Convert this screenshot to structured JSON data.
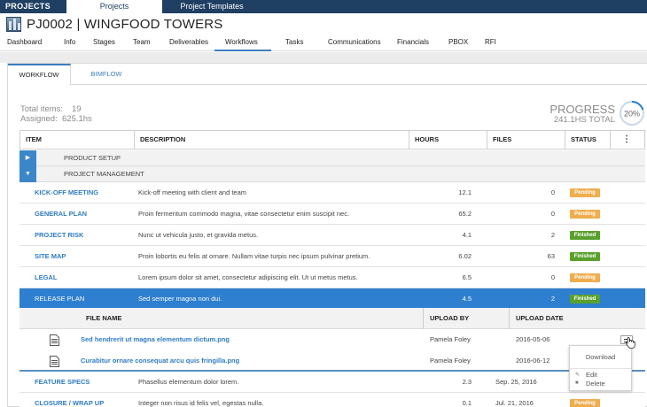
{
  "topbar": {
    "brand": "PROJECTS",
    "tabs": [
      "Projects",
      "Project Templates"
    ]
  },
  "header": {
    "title": "PJ0002 | WINGFOOD TOWERS"
  },
  "nav": {
    "items": [
      "Dashboard",
      "Info",
      "Stages",
      "Team",
      "Deliverables",
      "Workflows",
      "Tasks",
      "Communications",
      "Financials",
      "PBOX",
      "RFI"
    ],
    "active": "Workflows"
  },
  "workflow_tabs": [
    "WORKFLOW",
    "BIMFLOW"
  ],
  "summary": {
    "total_label": "Total items:",
    "total_value": "19",
    "assigned_label": "Assigned:",
    "assigned_value": "625.1hs"
  },
  "progress": {
    "label": "PROGRESS",
    "total": "241.1HS TOTAL",
    "percent": "20%",
    "fraction": 0.2
  },
  "columns": [
    "ITEM",
    "DESCRIPTION",
    "HOURS",
    "FILES",
    "STATUS"
  ],
  "groups": [
    "PRODUCT SETUP",
    "PROJECT MANAGEMENT"
  ],
  "rows": [
    {
      "name": "KICK-OFF MEETING",
      "desc": "Kick-off meeting with client and team",
      "hours": "12.1",
      "files": "0",
      "status": "Pending"
    },
    {
      "name": "GENERAL PLAN",
      "desc": "Proin fermentum commodo magna, vitae consectetur enim suscipit nec.",
      "hours": "65.2",
      "files": "0",
      "status": "Pending"
    },
    {
      "name": "PROJECT RISK",
      "desc": "Nunc ut vehicula justo, et gravida metus.",
      "hours": "4.1",
      "files": "2",
      "status": "Finished"
    },
    {
      "name": "SITE MAP",
      "desc": "Proin lobortis eu felis at ornare. Nullam vitae turpis nec ipsum pulvinar pretium.",
      "hours": "6.02",
      "files": "63",
      "status": "Finished"
    },
    {
      "name": "LEGAL",
      "desc": "Lorem ipsum dolor sit amet, consectetur adipiscing elit. Ut ut metus metus.",
      "hours": "6.5",
      "files": "0",
      "status": "Pending"
    },
    {
      "name": "RELEASE PLAN",
      "desc": "Sed semper magna non dui.",
      "hours": "4.5",
      "files": "2",
      "status": "Finished"
    }
  ],
  "files_table": {
    "columns": [
      "FILE NAME",
      "UPLOAD BY",
      "UPLOAD DATE"
    ],
    "rows": [
      {
        "name": "Sed hendrerit ut magna elementum dictum.png",
        "by": "Pamela Foley",
        "date": "2016-05-06"
      },
      {
        "name": "Curabitur ornare consequat arcu quis fringilla.png",
        "by": "Pamela Foley",
        "date": "2016-06-12"
      }
    ]
  },
  "rows_after": [
    {
      "name": "FEATURE SPECS",
      "desc": "Phasellus elementum dolor lorem.",
      "hours": "2.3",
      "files": "Sep. 25, 2016"
    },
    {
      "name": "CLOSURE / WRAP UP",
      "desc": "Integer non risus id felis vel, egestas nulla.",
      "hours": "0.1",
      "files": "Jul. 21, 2016",
      "status": "Pending"
    }
  ],
  "context_menu": {
    "items": [
      "Download",
      "Edit",
      "Delete"
    ]
  },
  "colors": {
    "navy": "#1f3f63",
    "accent": "#3b7dbf",
    "pending": "#f0ad4e",
    "finished": "#5aa02c",
    "selected": "#2e7fd0"
  }
}
